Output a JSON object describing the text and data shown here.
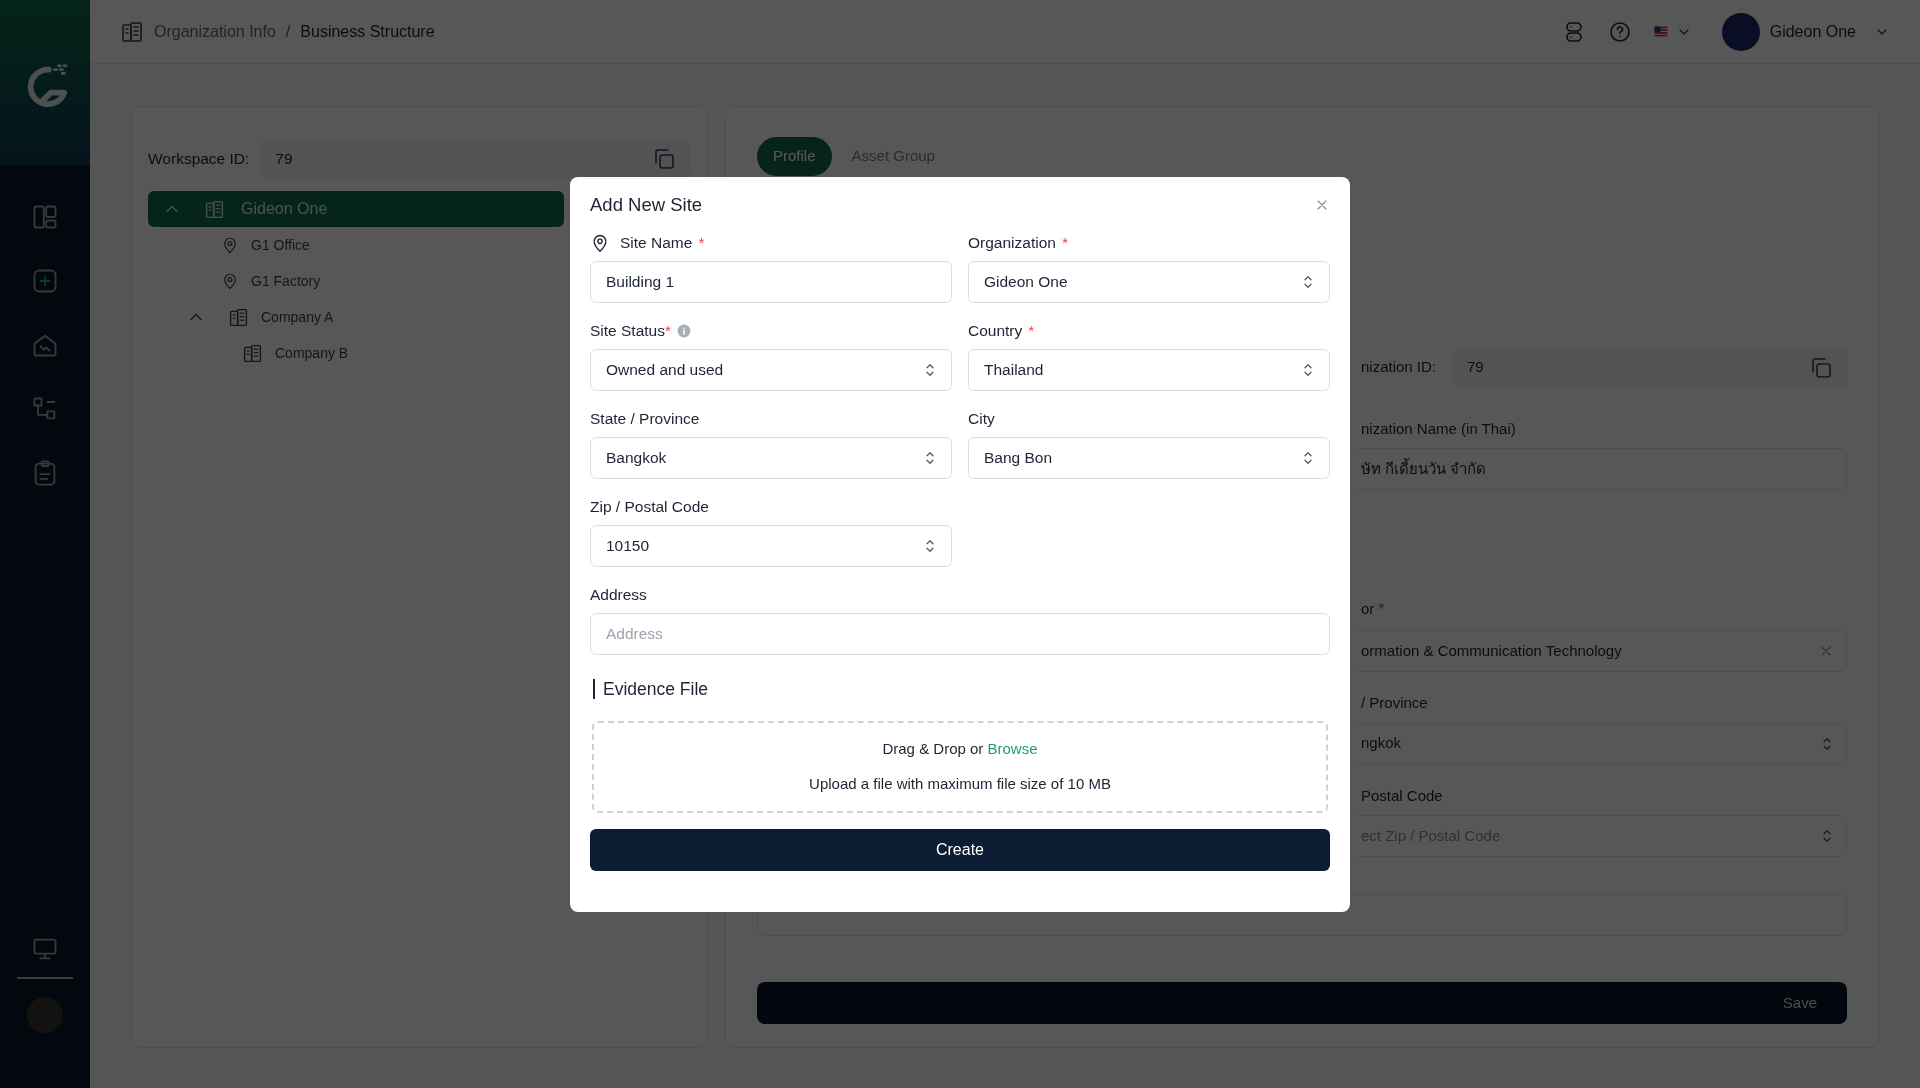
{
  "header": {
    "separator": "/",
    "breadcrumb": [
      {
        "label": "Organization Info",
        "selected": false
      },
      {
        "label": "Business Structure",
        "selected": true
      }
    ],
    "user": {
      "name": "Gideon One"
    }
  },
  "structure_panel": {
    "workspace_id_label": "Workspace ID:",
    "workspace_id": "79",
    "tree": [
      {
        "label": "Gideon One",
        "kind": "company",
        "selected": true,
        "expanded": true,
        "children": [
          {
            "label": "G1 Office",
            "kind": "site",
            "selected": false
          },
          {
            "label": "G1 Factory",
            "kind": "site",
            "selected": false
          },
          {
            "label": "Company A",
            "kind": "company",
            "selected": false,
            "expanded": true,
            "children": [
              {
                "label": "Company B",
                "kind": "company",
                "selected": false
              }
            ]
          }
        ]
      }
    ]
  },
  "profile_panel": {
    "tabs": [
      {
        "label": "Profile",
        "selected": true
      },
      {
        "label": "Asset Group",
        "selected": false
      }
    ],
    "fields": [
      {
        "kind": "id",
        "label": "nization ID:",
        "value": "79"
      },
      {
        "kind": "text",
        "label": "nization Name (in Thai)",
        "value": "ษัท กีเดี้ยนวัน จำกัด"
      },
      {
        "kind": "clearable",
        "label": "or",
        "required_mark": "*",
        "value": "ormation & Communication Technology"
      },
      {
        "kind": "select",
        "label": "/ Province",
        "value": "ngkok"
      },
      {
        "kind": "select",
        "label": "Postal Code",
        "placeholder": "ect Zip / Postal Code"
      },
      {
        "kind": "wide"
      }
    ],
    "save_button": "Save"
  },
  "modal": {
    "title": "Add New Site",
    "fields": [
      {
        "kind": "place",
        "label": "Site Name",
        "required_mark": "*",
        "value": "Building 1"
      },
      {
        "kind": "select",
        "label": "Organization",
        "required_mark": "*",
        "value": "Gideon One"
      },
      {
        "kind": "select",
        "label": "Site Status",
        "required_mark": "*",
        "info": true,
        "value": "Owned and used"
      },
      {
        "kind": "select",
        "label": "Country",
        "required_mark": "*",
        "value": "Thailand"
      },
      {
        "kind": "select",
        "label": "State / Province",
        "value": "Bangkok"
      },
      {
        "kind": "select",
        "label": "City",
        "value": "Bang Bon"
      },
      {
        "kind": "select",
        "label": "Zip / Postal Code",
        "value": "10150"
      },
      {
        "kind": "wide_text",
        "label": "Address",
        "placeholder": "Address"
      }
    ],
    "evidence": {
      "title": "Evidence File",
      "drop_text": "Drag & Drop or",
      "browse": "Browse",
      "hint": "Upload a file with maximum file size of 10 MB"
    },
    "create_button": "Create"
  }
}
